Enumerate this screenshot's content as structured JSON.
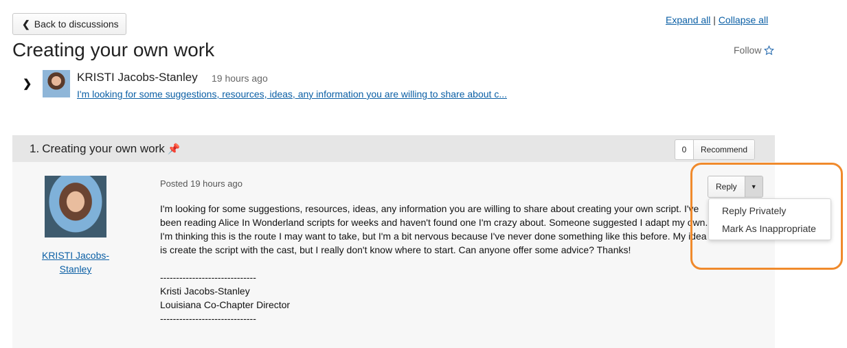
{
  "nav": {
    "back_label": "Back to discussions",
    "expand_all": "Expand all",
    "separator": "|",
    "collapse_all": "Collapse all"
  },
  "page": {
    "title": "Creating your own work",
    "follow_label": "Follow"
  },
  "thread": {
    "author": "KRISTI Jacobs-Stanley",
    "time": "19 hours ago",
    "excerpt": "I'm looking for some suggestions, resources, ideas, any information you are willing to share about c..."
  },
  "post": {
    "number": "1.",
    "title": "Creating your own work",
    "recommend_count": "0",
    "recommend_label": "Recommend",
    "author_line1": "KRISTI Jacobs-",
    "author_line2": "Stanley",
    "posted": "Posted 19 hours ago",
    "body": "I'm looking for some suggestions, resources, ideas, any information you are willing to share about creating your own script. I've been reading Alice In Wonderland scripts for weeks and haven't found one I'm crazy about. Someone suggested I adapt my own. I'm thinking this is the route I may want to take, but I'm a bit nervous because I've never done something like this before. My idea is create the script with the cast, but I really don't know where to start. Can anyone offer some advice? Thanks!",
    "sig_rule": "------------------------------",
    "sig_name": "Kristi Jacobs-Stanley",
    "sig_title": "Louisiana Co-Chapter Director",
    "sig_rule2": "------------------------------"
  },
  "reply": {
    "label": "Reply",
    "menu": [
      "Reply Privately",
      "Mark As Inappropriate"
    ]
  },
  "colors": {
    "link": "#0b5fa5",
    "highlight": "#f08a2c",
    "header_bg": "#e6e6e6"
  }
}
